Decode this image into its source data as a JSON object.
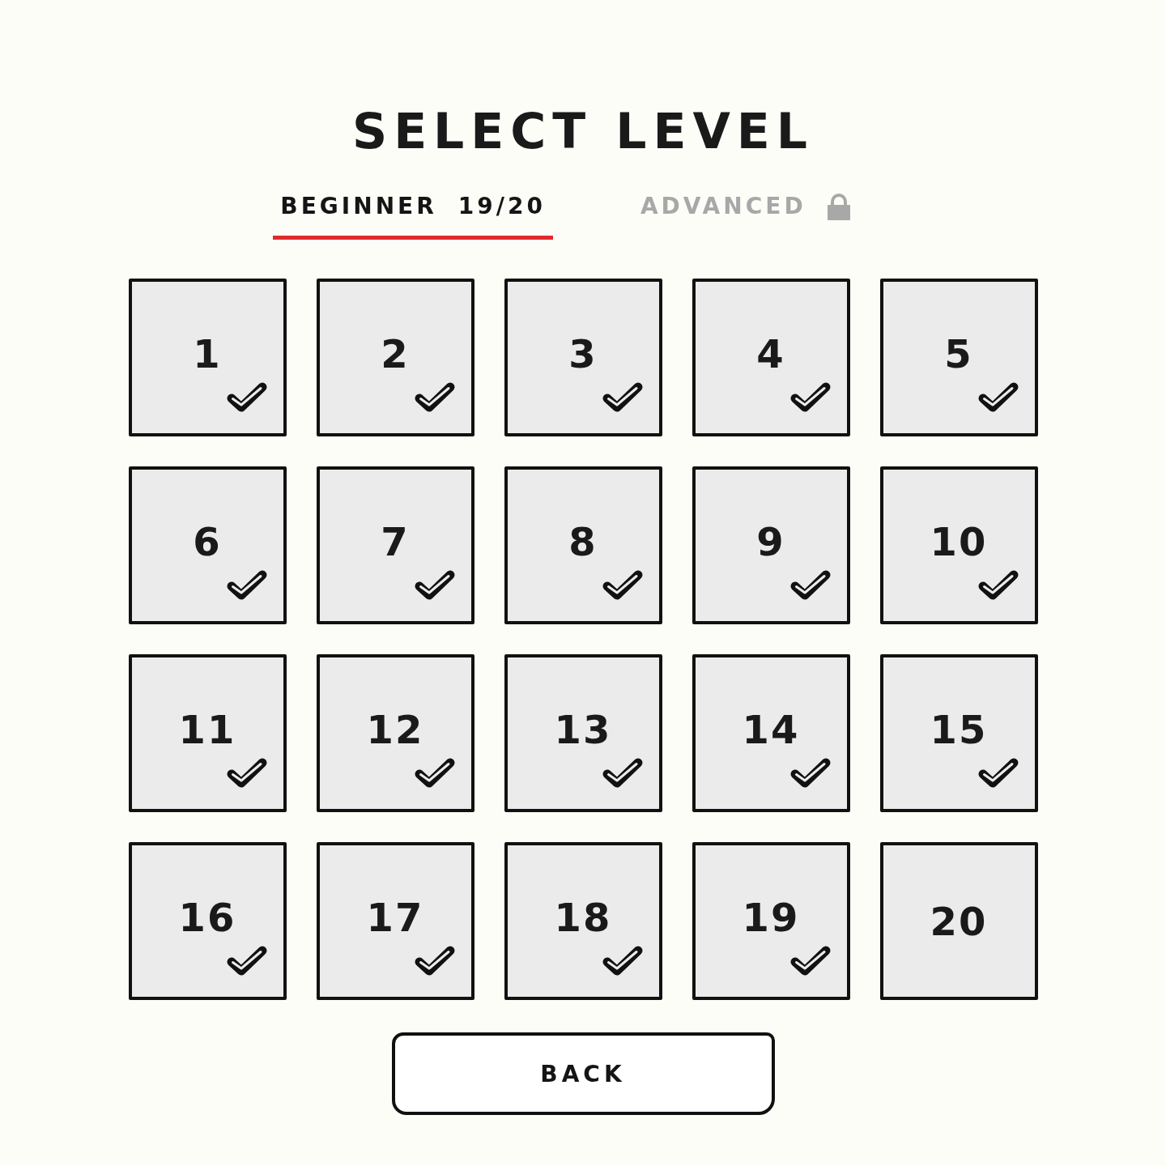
{
  "title": "SELECT LEVEL",
  "tabs": [
    {
      "label": "BEGINNER",
      "count": "19/20",
      "selected": true,
      "locked": false
    },
    {
      "label": "ADVANCED",
      "selected": false,
      "locked": true
    }
  ],
  "levels": [
    {
      "number": "1",
      "completed": true
    },
    {
      "number": "2",
      "completed": true
    },
    {
      "number": "3",
      "completed": true
    },
    {
      "number": "4",
      "completed": true
    },
    {
      "number": "5",
      "completed": true
    },
    {
      "number": "6",
      "completed": true
    },
    {
      "number": "7",
      "completed": true
    },
    {
      "number": "8",
      "completed": true
    },
    {
      "number": "9",
      "completed": true
    },
    {
      "number": "10",
      "completed": true
    },
    {
      "number": "11",
      "completed": true
    },
    {
      "number": "12",
      "completed": true
    },
    {
      "number": "13",
      "completed": true
    },
    {
      "number": "14",
      "completed": true
    },
    {
      "number": "15",
      "completed": true
    },
    {
      "number": "16",
      "completed": true
    },
    {
      "number": "17",
      "completed": true
    },
    {
      "number": "18",
      "completed": true
    },
    {
      "number": "19",
      "completed": true
    },
    {
      "number": "20",
      "completed": false
    }
  ],
  "back_button": "BACK"
}
